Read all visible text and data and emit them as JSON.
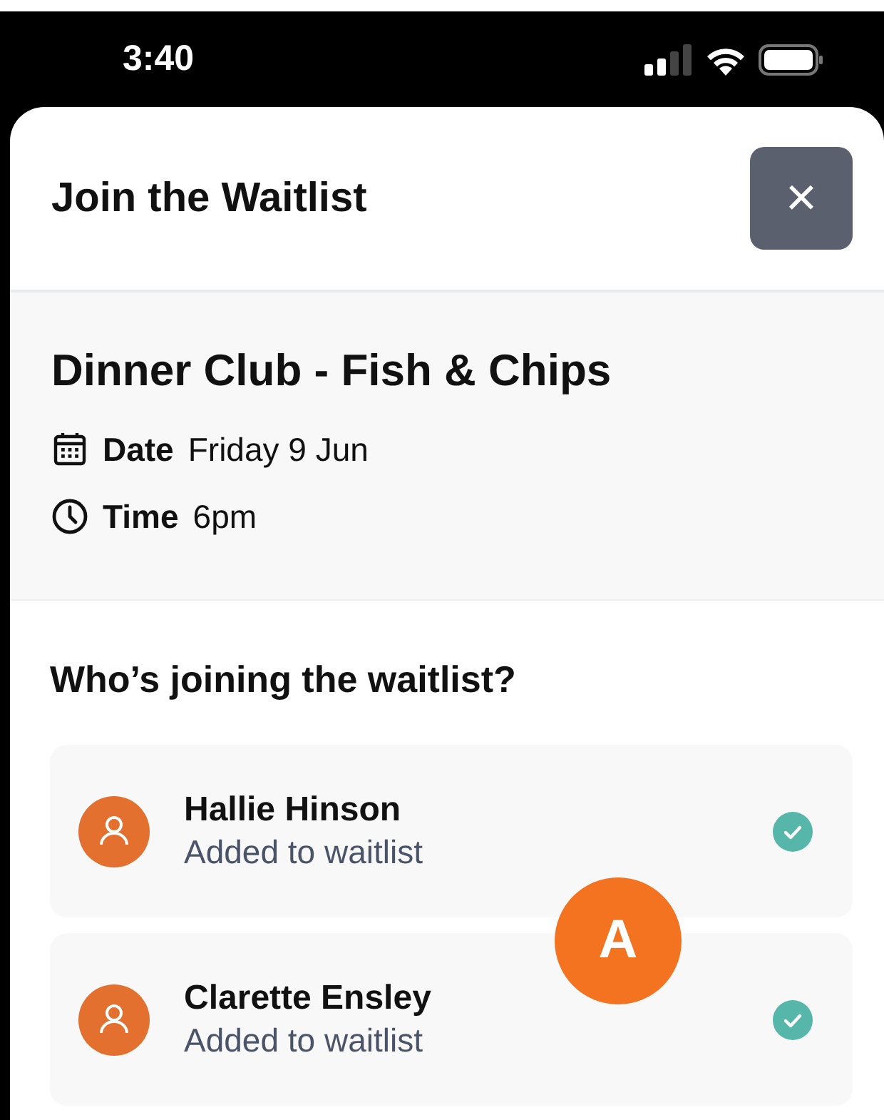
{
  "status_bar": {
    "time": "3:40"
  },
  "sheet": {
    "title": "Join the Waitlist",
    "close_label": "×"
  },
  "event": {
    "title": "Dinner Club - Fish & Chips",
    "details": [
      {
        "kind": "date",
        "label": "Date",
        "value": "Friday 9 Jun"
      },
      {
        "kind": "time",
        "label": "Time",
        "value": "6pm"
      }
    ]
  },
  "attendees": {
    "heading": "Who’s joining the waitlist?",
    "members": [
      {
        "name": "Hallie Hinson",
        "status": "Added to waitlist",
        "checked": true
      },
      {
        "name": "Clarette Ensley",
        "status": "Added to waitlist",
        "checked": true
      }
    ]
  },
  "annotation_marker": {
    "label": "A"
  }
}
